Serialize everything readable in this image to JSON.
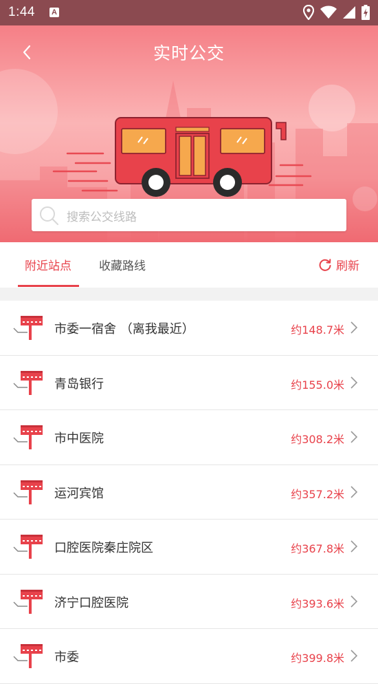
{
  "status_bar": {
    "time": "1:44",
    "notification_letter": "A"
  },
  "header": {
    "title": "实时公交"
  },
  "search": {
    "placeholder": "搜索公交线路"
  },
  "tabs": [
    {
      "label": "附近站点",
      "active": true
    },
    {
      "label": "收藏路线",
      "active": false
    }
  ],
  "refresh": {
    "label": "刷新"
  },
  "stations": [
    {
      "name": "市委一宿舍 （离我最近）",
      "distance": "约148.7米"
    },
    {
      "name": "青岛银行",
      "distance": "约155.0米"
    },
    {
      "name": "市中医院",
      "distance": "约308.2米"
    },
    {
      "name": "运河宾馆",
      "distance": "约357.2米"
    },
    {
      "name": "口腔医院秦庄院区",
      "distance": "约367.8米"
    },
    {
      "name": "济宁口腔医院",
      "distance": "约393.6米"
    },
    {
      "name": "市委",
      "distance": "约399.8米"
    }
  ],
  "colors": {
    "accent": "#e8424b",
    "status_bar": "#8b4a50"
  }
}
